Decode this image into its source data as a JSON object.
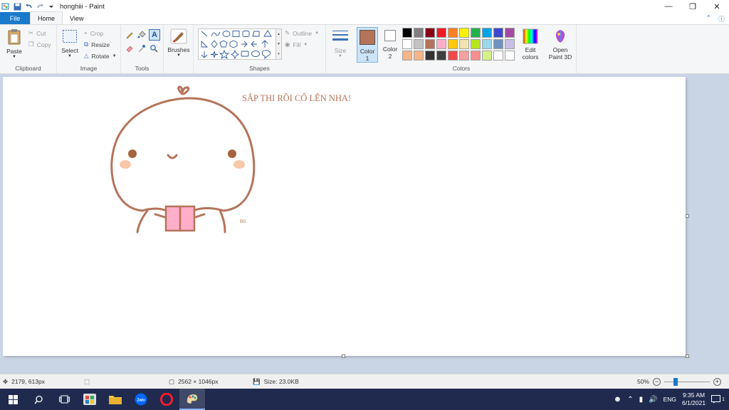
{
  "window": {
    "title": "honghiii - Paint"
  },
  "tabs": [
    {
      "label": "File"
    },
    {
      "label": "Home"
    },
    {
      "label": "View"
    }
  ],
  "ribbon": {
    "clipboard": {
      "label": "Clipboard",
      "paste": "Paste",
      "cut": "Cut",
      "copy": "Copy"
    },
    "image": {
      "label": "Image",
      "select": "Select",
      "crop": "Crop",
      "resize": "Resize",
      "rotate": "Rotate"
    },
    "tools": {
      "label": "Tools"
    },
    "brushes": {
      "label": "Brushes"
    },
    "shapes": {
      "label": "Shapes",
      "outline": "Outline",
      "fill": "Fill"
    },
    "size": {
      "label": "Size"
    },
    "color1": {
      "label": "Color",
      "label2": "1",
      "value": "#b5735a"
    },
    "color2": {
      "label": "Color",
      "label2": "2",
      "value": "#ffffff"
    },
    "colors": {
      "label": "Colors"
    },
    "edit_colors": {
      "line1": "Edit",
      "line2": "colors"
    },
    "paint3d": {
      "line1": "Open",
      "line2": "Paint 3D"
    },
    "palette": [
      "#000000",
      "#7f7f7f",
      "#880015",
      "#ed1c24",
      "#ff7f27",
      "#fff200",
      "#22b14c",
      "#00a2e8",
      "#3f48cc",
      "#a349a4",
      "#ffffff",
      "#c3c3c3",
      "#b5735a",
      "#ffaec9",
      "#ffc90e",
      "#efe4b0",
      "#b5e61d",
      "#99d9ea",
      "#7092be",
      "#c8bfe7",
      "#f7b589",
      "#f4b58a",
      "#333333",
      "#3f3f3f",
      "#ef4b4b",
      "#f4a0a0",
      "#f88e8e",
      "#d6f08b",
      "#ffffff",
      "#ffffff"
    ]
  },
  "canvas": {
    "text": "SẮP THI RỒI CỐ LÊN NHA!",
    "signature": "BG",
    "accent": "#b5735a"
  },
  "status": {
    "cursor_pos": "2179, 613px",
    "image_size": "2562 × 1046px",
    "file_size": "Size: 23.0KB",
    "zoom": "50%",
    "zoom_level": 0.5
  },
  "taskbar": {
    "lang": "ENG",
    "time": "9:35 AM",
    "date": "6/1/2021",
    "notification_count": "1"
  }
}
